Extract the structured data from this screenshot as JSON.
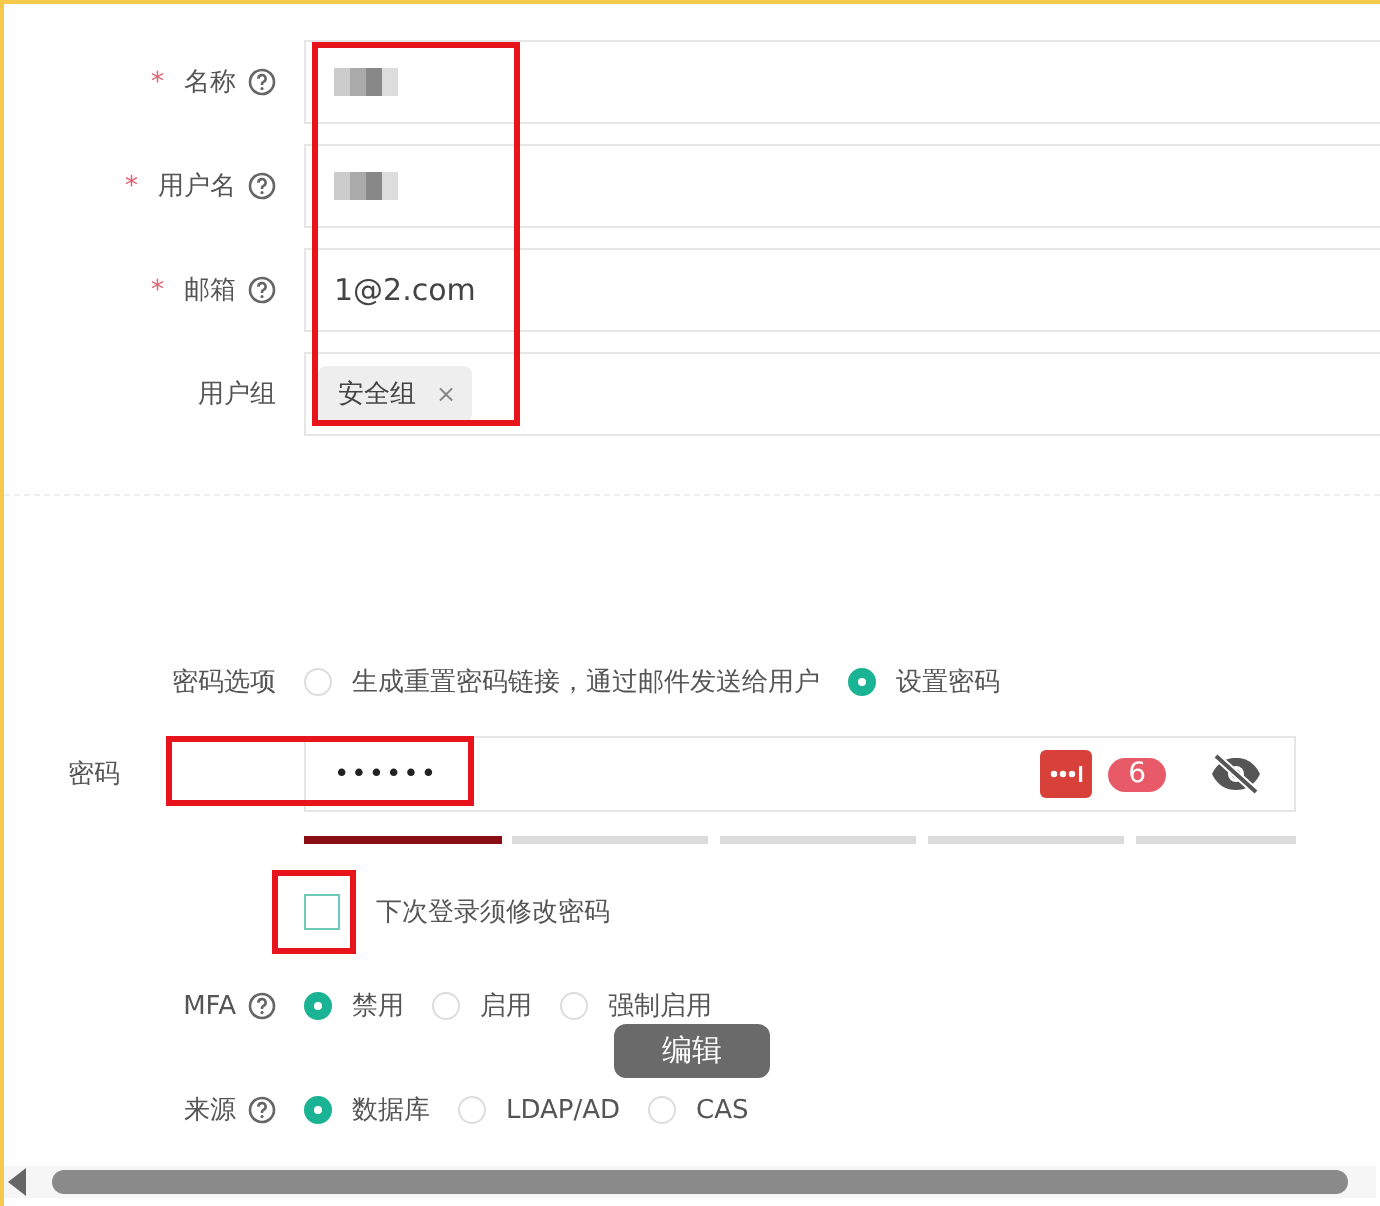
{
  "fields": [
    {
      "label": "名称",
      "required_mark": "*",
      "help": true,
      "kind": "blurred"
    },
    {
      "label": "用户名",
      "required_mark": "*",
      "help": true,
      "kind": "blurred"
    },
    {
      "label": "邮箱",
      "required_mark": "*",
      "help": true,
      "kind": "text",
      "value": "1@2.com"
    },
    {
      "label": "用户组",
      "help": false,
      "kind": "tags",
      "tags": [
        {
          "label": "安全组",
          "remove": "×"
        }
      ]
    }
  ],
  "fields_outlined": true,
  "password_option": {
    "label": "密码选项",
    "options": [
      {
        "label": "生成重置密码链接，通过邮件发送给用户",
        "selected": false
      },
      {
        "label": "设置密码",
        "selected": true
      }
    ]
  },
  "password": {
    "label": "密码",
    "value": "••••••",
    "count": "6",
    "outlined": true,
    "strength": {
      "level": 0.2
    }
  },
  "must_change": {
    "label": "下次登录须修改密码",
    "checked": false,
    "outlined": true
  },
  "mfa": {
    "label": "MFA",
    "help": true,
    "options": [
      {
        "label": "禁用",
        "selected": true
      },
      {
        "label": "启用",
        "selected": false
      },
      {
        "label": "强制启用",
        "selected": false
      }
    ]
  },
  "source": {
    "label": "来源",
    "help": true,
    "options": [
      {
        "label": "数据库",
        "selected": true
      },
      {
        "label": "LDAP/AD",
        "selected": false
      },
      {
        "label": "CAS",
        "selected": false
      }
    ]
  },
  "tooltip": "编辑"
}
